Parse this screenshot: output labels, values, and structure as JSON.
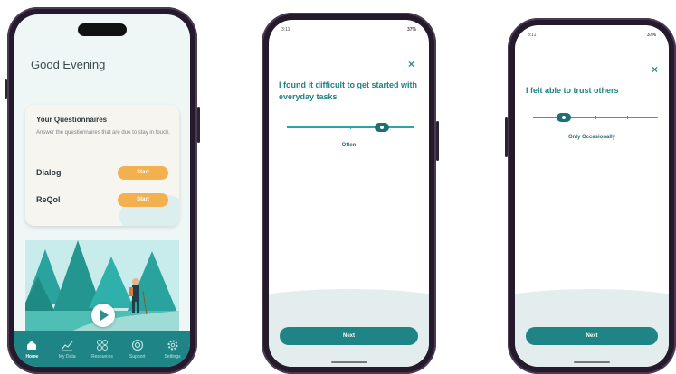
{
  "phone1": {
    "greeting": "Good Evening",
    "questionnaires": {
      "title": "Your Questionnaires",
      "description": "Answer the questionnaires that are due to stay in touch.",
      "items": [
        {
          "name": "Dialog",
          "button": "Start"
        },
        {
          "name": "ReQol",
          "button": "Start"
        }
      ]
    },
    "nav": [
      {
        "label": "Home",
        "icon": "home-icon"
      },
      {
        "label": "My Data",
        "icon": "chart-icon"
      },
      {
        "label": "Resources",
        "icon": "grid-icon"
      },
      {
        "label": "Support",
        "icon": "lifebuoy-icon"
      },
      {
        "label": "Settings",
        "icon": "gear-icon"
      }
    ]
  },
  "phone2": {
    "time": "3:11",
    "battery": "37%",
    "close": "×",
    "question": "I found it difficult to get started with everyday tasks",
    "slider_value": 0.75,
    "answer": "Often",
    "next": "Next"
  },
  "phone3": {
    "time": "3:11",
    "battery": "37%",
    "close": "×",
    "question": "I felt able to trust others",
    "slider_value": 0.25,
    "answer": "Only Occasionally",
    "next": "Next"
  },
  "colors": {
    "teal": "#1f8486",
    "accent": "#2fa4a4",
    "start_button": "#f2b04e",
    "phone_frame": "#241a2b"
  }
}
